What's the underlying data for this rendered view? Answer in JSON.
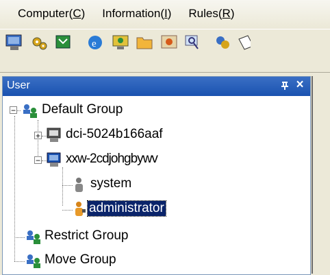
{
  "menubar": {
    "items": [
      {
        "label": "Computer",
        "mnemonic": "C"
      },
      {
        "label": "Information",
        "mnemonic": "I"
      },
      {
        "label": "Rules",
        "mnemonic": "R"
      }
    ]
  },
  "toolbar": {
    "icons": [
      "computer-icon",
      "settings-icon",
      "network-icon",
      "browser-icon",
      "monitor-icon",
      "folder-icon",
      "screen-icon",
      "search-icon",
      "tools-icon",
      "notes-icon"
    ]
  },
  "panel": {
    "title": "User",
    "pin_glyph": "ᵾ",
    "close_glyph": "×"
  },
  "tree": {
    "default_group": "Default Group",
    "computer1": "dci-5024b166aaf",
    "computer2": "xxw-2cdjohgbywv",
    "user_system": "system",
    "user_admin": "administrator",
    "restrict_group": "Restrict Group",
    "move_group": "Move Group"
  },
  "colors": {
    "title_bar": "#1a52b0",
    "selection": "#0a246a"
  }
}
